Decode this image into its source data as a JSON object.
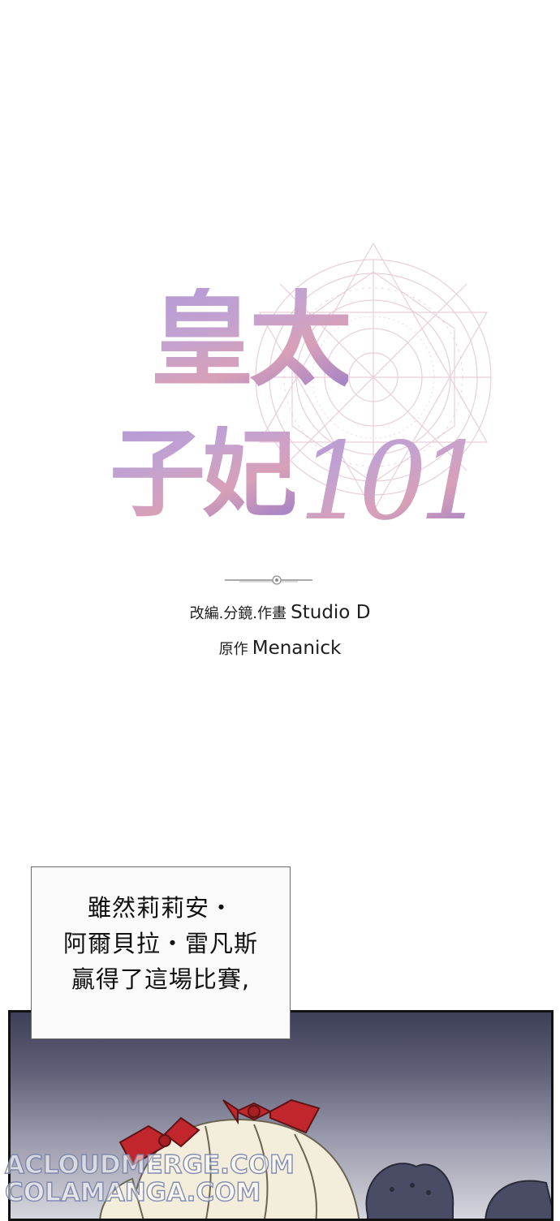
{
  "logo": {
    "title_line1": "皇太",
    "title_line2": "子妃",
    "title_number": "101"
  },
  "credits": {
    "adaptation_label": "改編.分鏡.作畫",
    "adaptation_name": "Studio D",
    "original_label": "原作",
    "original_name": "Menanick"
  },
  "caption": {
    "line1": "雖然莉莉安・",
    "line2": "阿爾貝拉・雷凡斯",
    "line3": "贏得了這場比賽,"
  },
  "watermark": {
    "line1": "ACLOUDMERGE.COM",
    "line2": "COLAMANGA.COM"
  },
  "colors": {
    "title_gradient_start": "#b49ad6",
    "title_gradient_end": "#d8a0b7",
    "panel_bg_top": "#3e3f58",
    "ribbon": "#c0262b",
    "hair": "#f3eedc"
  }
}
